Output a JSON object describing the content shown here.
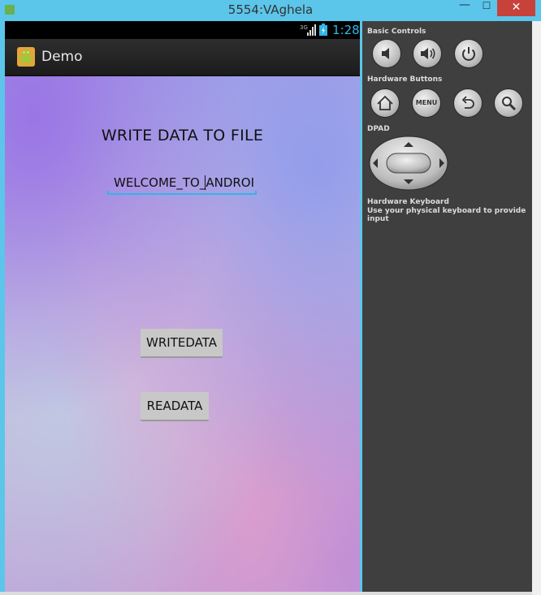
{
  "window": {
    "title": "5554:VAghela",
    "minimize_glyph": "—",
    "maximize_glyph": "☐",
    "close_glyph": "✕"
  },
  "statusbar": {
    "network": "3G",
    "time": "1:28"
  },
  "actionbar": {
    "app_title": "Demo",
    "icon": "android-icon"
  },
  "content": {
    "heading": "WRITE DATA TO FILE",
    "input_value": "WELCOME_TO_ANDROI",
    "write_button": "WRITEDATA",
    "read_button": "READATA",
    "accent_color": "#33b5e5"
  },
  "panel": {
    "basic_controls_label": "Basic Controls",
    "basic_controls": [
      "volume-down-icon",
      "volume-up-icon",
      "power-icon"
    ],
    "hardware_buttons_label": "Hardware Buttons",
    "hardware_buttons": [
      "home-icon",
      "menu-button",
      "back-icon",
      "search-icon"
    ],
    "menu_label": "MENU",
    "dpad_label": "DPAD",
    "keyboard_title": "Hardware Keyboard",
    "keyboard_hint": "Use your physical keyboard to provide input"
  }
}
